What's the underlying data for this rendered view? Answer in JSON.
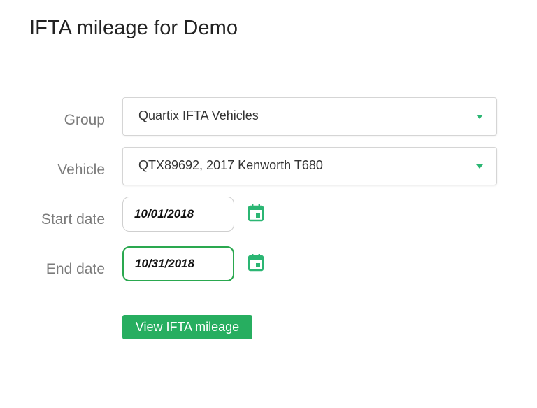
{
  "page": {
    "title": "IFTA mileage for Demo"
  },
  "form": {
    "group": {
      "label": "Group",
      "value": "Quartix IFTA Vehicles"
    },
    "vehicle": {
      "label": "Vehicle",
      "value": "QTX89692, 2017 Kenworth T680"
    },
    "start_date": {
      "label": "Start date",
      "value": "10/01/2018"
    },
    "end_date": {
      "label": "End date",
      "value": "10/31/2018"
    },
    "submit_label": "View IFTA mileage"
  },
  "icons": {
    "dropdown": "chevron-down-icon",
    "calendar": "calendar-icon"
  },
  "colors": {
    "accent": "#2bb673",
    "button": "#27ae60",
    "focus_border": "#2aa84f",
    "label_text": "#7b7b7b"
  }
}
